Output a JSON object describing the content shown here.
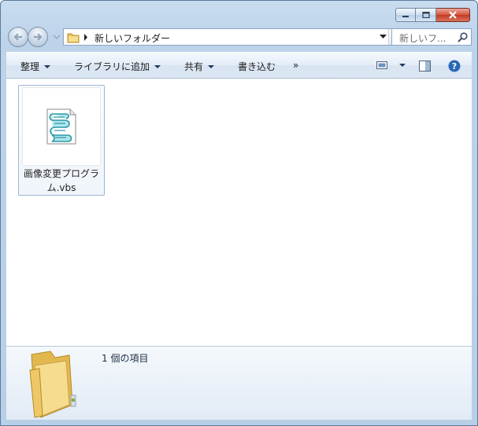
{
  "window": {
    "caption_buttons": [
      {
        "name": "minimize",
        "icon": "minimize-icon"
      },
      {
        "name": "maximize",
        "icon": "maximize-icon"
      },
      {
        "name": "close",
        "icon": "close-icon"
      }
    ]
  },
  "nav": {
    "back_icon": "back-arrow-icon",
    "forward_icon": "forward-arrow-icon",
    "history_icon": "history-dropdown-icon",
    "address": {
      "folder_icon": "folder-icon",
      "path": "新しいフォルダー",
      "dropdown_icon": "dropdown-arrow-icon",
      "refresh_icon": "refresh-icon"
    },
    "search": {
      "placeholder": "新しいフ...",
      "icon": "search-icon"
    }
  },
  "toolbar": {
    "organize": "整理",
    "include_in_library": "ライブラリに追加",
    "share": "共有",
    "burn": "書き込む",
    "more": "»",
    "view_icon": "change-view-icon",
    "preview_pane_icon": "preview-pane-icon",
    "help_icon": "help-icon"
  },
  "files": [
    {
      "name": "画像変更プログラム.vbs",
      "icon": "vbs-script-icon",
      "selected": true
    }
  ],
  "details": {
    "icon": "folder-icon",
    "item_count": "1 個の項目"
  },
  "colors": {
    "frame": "#bcd3ea",
    "selection_border": "#9db6d3",
    "script_teal": "#3fb8c9",
    "folder_yellow": "#f2d27a",
    "close_red": "#c23a22"
  }
}
